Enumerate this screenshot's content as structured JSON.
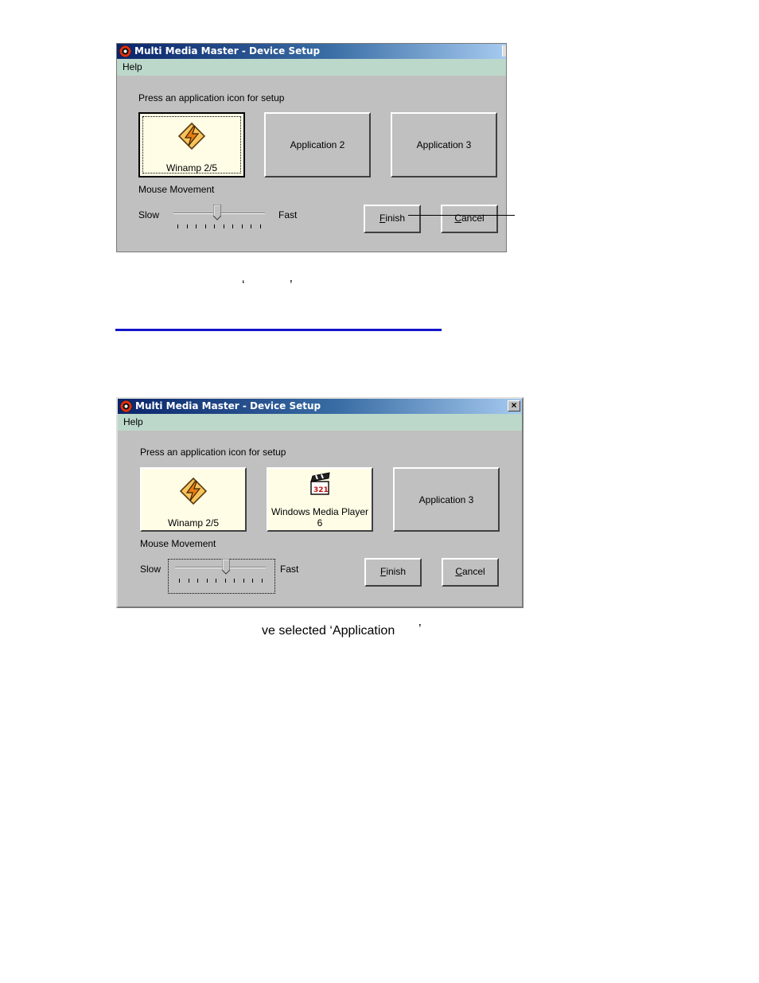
{
  "colors": {
    "title_start": "#0a246a",
    "menubar": "#bcd8ca",
    "face": "#c0c0c0",
    "selected_button": "#fffde6",
    "rule": "#1414cc"
  },
  "window1": {
    "title": "Multi Media Master - Device Setup",
    "menu": "Help",
    "prompt": "Press an application icon for setup",
    "apps": [
      {
        "label": "Winamp 2/5",
        "icon": "winamp-icon"
      },
      {
        "label": "Application 2"
      },
      {
        "label": "Application 3"
      }
    ],
    "mouse_movement_label": "Mouse Movement",
    "slow_label": "Slow",
    "fast_label": "Fast",
    "slider_level": 0.48,
    "finish_label": "Finish",
    "cancel_label": "Cancel"
  },
  "caption1": {
    "open_quote": "‘",
    "close_quote": "’"
  },
  "window2": {
    "title": "Multi Media Master - Device Setup",
    "menu": "Help",
    "prompt": "Press an application icon for setup",
    "apps": [
      {
        "label": "Winamp 2/5",
        "icon": "winamp-icon"
      },
      {
        "label": "Windows Media Player",
        "label2": "6",
        "icon": "clapperboard-icon"
      },
      {
        "label": "Application 3"
      }
    ],
    "mouse_movement_label": "Mouse Movement",
    "slow_label": "Slow",
    "fast_label": "Fast",
    "slider_level": 0.56,
    "finish_label": "Finish",
    "cancel_label": "Cancel",
    "close_glyph": "×"
  },
  "caption2": {
    "text": "ve selected ‘Application",
    "close_quote": "’"
  }
}
